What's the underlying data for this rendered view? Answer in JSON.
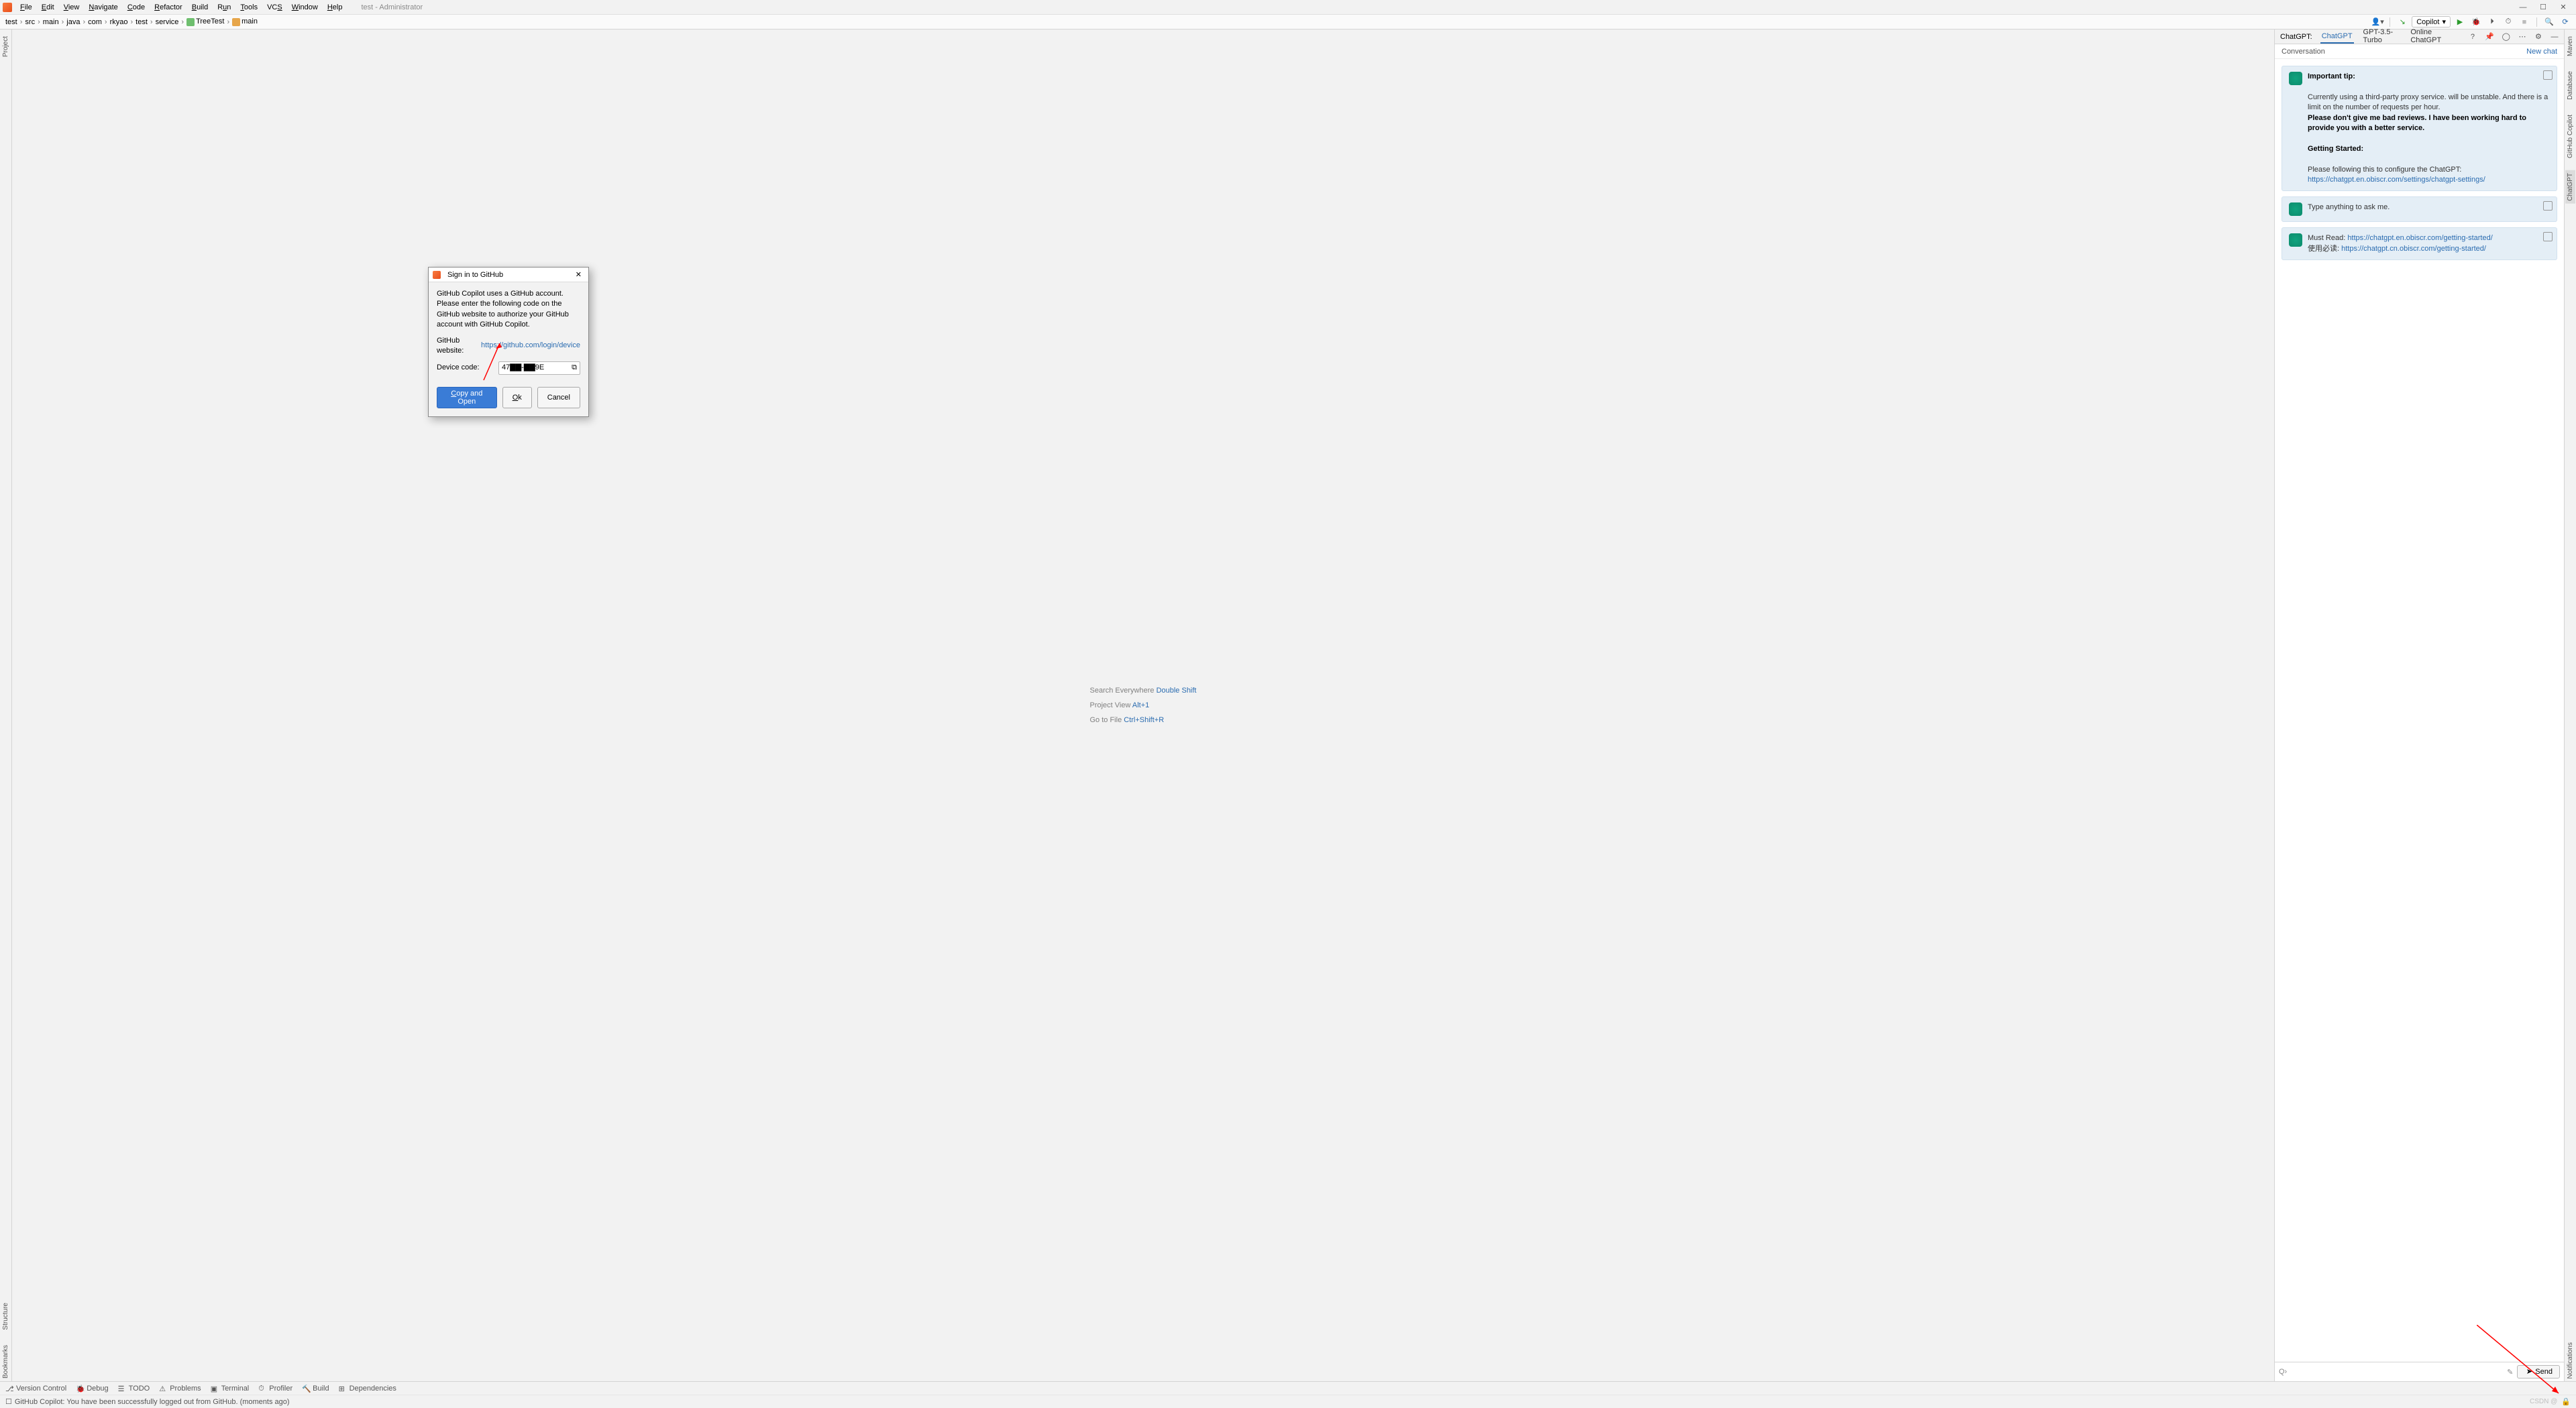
{
  "titlebar": {
    "menus": [
      "File",
      "Edit",
      "View",
      "Navigate",
      "Code",
      "Refactor",
      "Build",
      "Run",
      "Tools",
      "VCS",
      "Window",
      "Help"
    ],
    "title": "test - Administrator"
  },
  "breadcrumb": [
    "test",
    "src",
    "main",
    "java",
    "com",
    "rkyao",
    "test",
    "service",
    "TreeTest",
    "main"
  ],
  "nav_right": {
    "copilot_label": "Copilot"
  },
  "left_strip": [
    "Project"
  ],
  "left_strip_bottom": [
    "Structure",
    "Bookmarks"
  ],
  "right_strip": [
    "Maven",
    "Database",
    "GitHub Copilot",
    "ChatGPT"
  ],
  "right_strip_bottom": [
    "Notifications"
  ],
  "editor_hints": [
    {
      "label": "Search Everywhere",
      "key": "Double Shift"
    },
    {
      "label": "Project View",
      "key": "Alt+1"
    },
    {
      "label": "Go to File",
      "key": "Ctrl+Shift+R"
    }
  ],
  "chat": {
    "title_label": "ChatGPT:",
    "tabs": [
      "ChatGPT",
      "GPT-3.5-Turbo",
      "Online ChatGPT"
    ],
    "active_tab": "ChatGPT",
    "sub_label": "Conversation",
    "new_chat": "New chat",
    "messages": [
      {
        "important": "Important tip:",
        "line1": "Currently using a third-party proxy service. will be unstable. And there is a limit on the number of requests per hour.",
        "line2": "Please don't give me bad reviews. I have been working hard to provide you with a better service.",
        "gs": "Getting Started:",
        "cfg_prefix": "Please following this to configure the ChatGPT: ",
        "cfg_link": "https://chatgpt.en.obiscr.com/settings/chatgpt-settings/"
      },
      {
        "line": "Type anything to ask me."
      },
      {
        "must_prefix": "Must Read: ",
        "must_link": "https://chatgpt.en.obiscr.com/getting-started/",
        "cn_prefix": "使用必读: ",
        "cn_link": "https://chatgpt.cn.obiscr.com/getting-started/"
      }
    ],
    "input_placeholder": "",
    "send": "Send"
  },
  "dialog": {
    "title": "Sign in to GitHub",
    "desc": "GitHub Copilot uses a GitHub account. Please enter the following code on the GitHub website to authorize your GitHub account with GitHub Copilot.",
    "website_label": "GitHub website:",
    "website_url": "https://github.com/login/device",
    "code_label": "Device code:",
    "code_value": "47▇▇-▇▇9E",
    "btn_primary": "Copy and Open",
    "btn_ok": "Ok",
    "btn_cancel": "Cancel"
  },
  "bottom_tools": [
    "Version Control",
    "Debug",
    "TODO",
    "Problems",
    "Terminal",
    "Profiler",
    "Build",
    "Dependencies"
  ],
  "status": {
    "text": "GitHub Copilot: You have been successfully logged out from GitHub. (moments ago)",
    "watermark": "CSDN @"
  },
  "win_controls": {
    "min": "—",
    "max": "☐",
    "close": "✕"
  }
}
